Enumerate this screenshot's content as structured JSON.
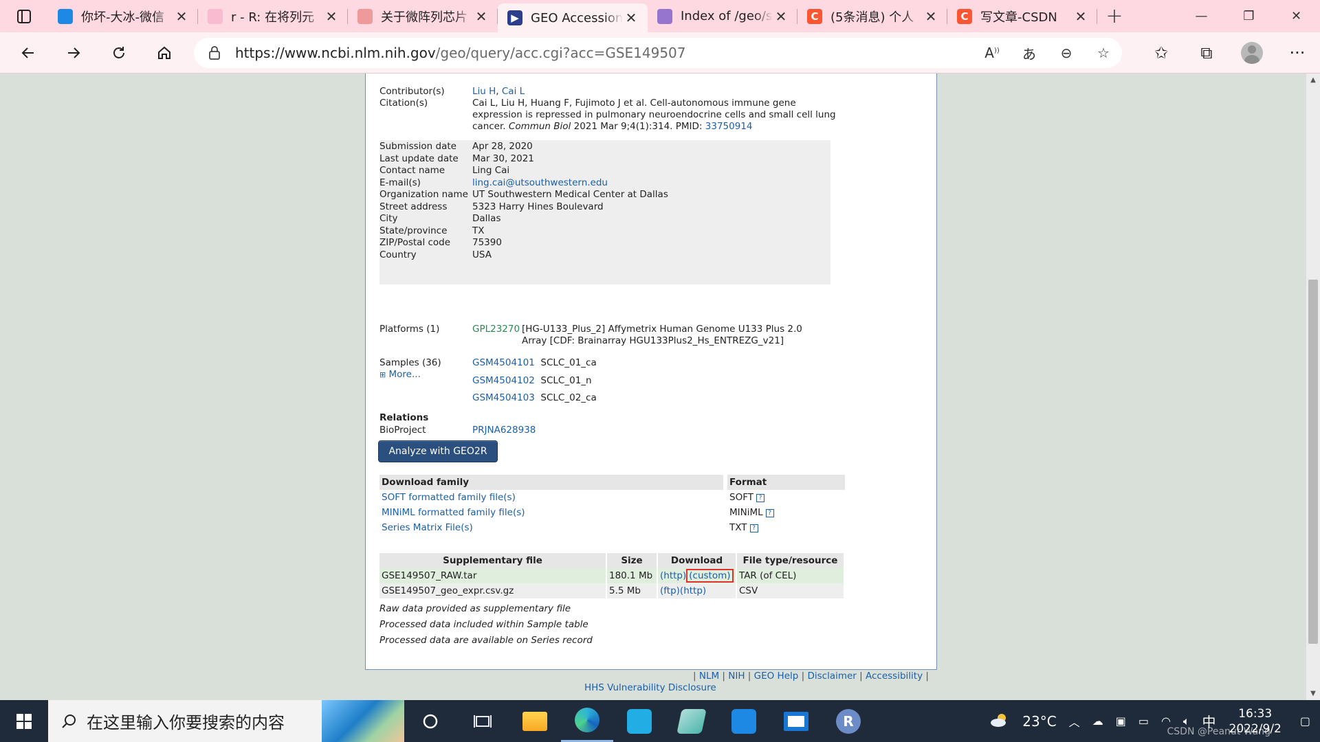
{
  "browser": {
    "tabs": [
      {
        "title": "你坏-大冰-微信",
        "favicon": "#1e88e5"
      },
      {
        "title": "r - R: 在将列元",
        "favicon": "#f48fb1"
      },
      {
        "title": "关于微阵列芯片",
        "favicon": "#e57373"
      },
      {
        "title": "GEO Accession",
        "favicon": "#2b3e8c",
        "active": true
      },
      {
        "title": "Index of /geo/s",
        "favicon": "#7e57c2"
      },
      {
        "title": "(5条消息) 个人",
        "favicon": "#fc5531"
      },
      {
        "title": "写文章-CSDN",
        "favicon": "#fc5531"
      }
    ],
    "url_host": "https://www.ncbi.nlm.nih.gov",
    "url_path": "/geo/query/acc.cgi?acc=GSE149507"
  },
  "record": {
    "contributors_label": "Contributor(s)",
    "contributors": [
      "Liu H",
      "Cai L"
    ],
    "citation_label": "Citation(s)",
    "citation_line1": "Cai L, Liu H, Huang F, Fujimoto J et al. Cell-autonomous immune gene",
    "citation_line2": "expression is repressed in pulmonary neuroendocrine cells and small cell lung",
    "citation_line3_pre": "cancer.",
    "citation_journal": "Commun Biol",
    "citation_line3_post": "2021 Mar 9;4(1):314. PMID:",
    "pmid": "33750914",
    "info": [
      {
        "label": "Submission date",
        "value": "Apr 28, 2020"
      },
      {
        "label": "Last update date",
        "value": "Mar 30, 2021"
      },
      {
        "label": "Contact name",
        "value": "Ling Cai"
      },
      {
        "label": "E-mail(s)",
        "value": "ling.cai@utsouthwestern.edu",
        "link": true
      },
      {
        "label": "Organization name",
        "value": "UT Southwestern Medical Center at Dallas"
      },
      {
        "label": "Street address",
        "value": "5323 Harry Hines Boulevard"
      },
      {
        "label": "City",
        "value": "Dallas"
      },
      {
        "label": "State/province",
        "value": "TX"
      },
      {
        "label": "ZIP/Postal code",
        "value": "75390"
      },
      {
        "label": "Country",
        "value": "USA"
      }
    ],
    "platforms_label": "Platforms (1)",
    "platform_id": "GPL23270",
    "platform_desc1": "[HG-U133_Plus_2] Affymetrix Human Genome U133 Plus 2.0",
    "platform_desc2": "Array [CDF: Brainarray HGU133Plus2_Hs_ENTREZG_v21]",
    "samples_label": "Samples (36)",
    "more_label": "More...",
    "samples": [
      {
        "id": "GSM4504101",
        "name": "SCLC_01_ca"
      },
      {
        "id": "GSM4504102",
        "name": "SCLC_01_n"
      },
      {
        "id": "GSM4504103",
        "name": "SCLC_02_ca"
      }
    ],
    "relations_label": "Relations",
    "bioproject_label": "BioProject",
    "bioproject_id": "PRJNA628938",
    "geo2r_label": "Analyze with GEO2R"
  },
  "download_family": {
    "header": "Download family",
    "format_header": "Format",
    "rows": [
      {
        "name": "SOFT formatted family file(s)",
        "format": "SOFT"
      },
      {
        "name": "MINiML formatted family file(s)",
        "format": "MINiML"
      },
      {
        "name": "Series Matrix File(s)",
        "format": "TXT"
      }
    ]
  },
  "supplementary": {
    "headers": [
      "Supplementary file",
      "Size",
      "Download",
      "File type/resource"
    ],
    "rows": [
      {
        "file": "GSE149507_RAW.tar",
        "size": "180.1 Mb",
        "dl1": "(http)",
        "dl2": "(custom)",
        "type": "TAR (of CEL)"
      },
      {
        "file": "GSE149507_geo_expr.csv.gz",
        "size": "5.5 Mb",
        "dl1": "(ftp)",
        "dl2": "(http)",
        "type": "CSV"
      }
    ],
    "notes": [
      "Raw data provided as supplementary file",
      "Processed data included within Sample table",
      "Processed data are available on Series record"
    ]
  },
  "footer": {
    "links": [
      "NLM",
      "NIH",
      "GEO Help",
      "Disclaimer",
      "Accessibility"
    ],
    "hhs": "HHS Vulnerability Disclosure"
  },
  "taskbar": {
    "search_placeholder": "在这里输入你要搜索的内容",
    "weather": "23°C",
    "ime": "中",
    "time": "16:33",
    "date": "2022/9/2",
    "watermark": "CSDN @Peanut Wang"
  }
}
